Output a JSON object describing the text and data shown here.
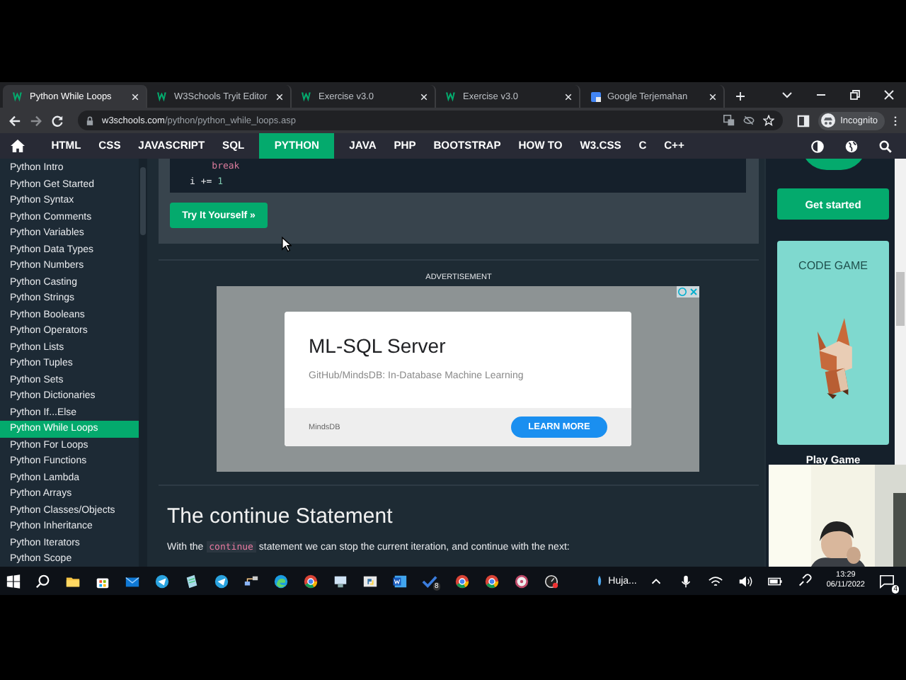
{
  "browser": {
    "tabs": [
      {
        "title": "Python While Loops",
        "selected": true
      },
      {
        "title": "W3Schools Tryit Editor",
        "selected": false
      },
      {
        "title": "Exercise v3.0",
        "selected": false
      },
      {
        "title": "Exercise v3.0",
        "selected": false
      },
      {
        "title": "Google Terjemahan",
        "selected": false
      }
    ],
    "address": {
      "host": "w3schools.com",
      "path": "/python/python_while_loops.asp"
    },
    "profile": "Incognito"
  },
  "nav": {
    "items": [
      {
        "label": "HTML",
        "selected": false
      },
      {
        "label": "CSS",
        "selected": false
      },
      {
        "label": "JAVASCRIPT",
        "selected": false
      },
      {
        "label": "SQL",
        "selected": false
      },
      {
        "label": "PYTHON",
        "selected": true
      },
      {
        "label": "JAVA",
        "selected": false
      },
      {
        "label": "PHP",
        "selected": false
      },
      {
        "label": "BOOTSTRAP",
        "selected": false
      },
      {
        "label": "HOW TO",
        "selected": false
      },
      {
        "label": "W3.CSS",
        "selected": false
      },
      {
        "label": "C",
        "selected": false
      },
      {
        "label": "C++",
        "selected": false
      }
    ]
  },
  "sidebar": {
    "items": [
      {
        "label": "Python Intro",
        "selected": false
      },
      {
        "label": "Python Get Started",
        "selected": false
      },
      {
        "label": "Python Syntax",
        "selected": false
      },
      {
        "label": "Python Comments",
        "selected": false
      },
      {
        "label": "Python Variables",
        "selected": false
      },
      {
        "label": "Python Data Types",
        "selected": false
      },
      {
        "label": "Python Numbers",
        "selected": false
      },
      {
        "label": "Python Casting",
        "selected": false
      },
      {
        "label": "Python Strings",
        "selected": false
      },
      {
        "label": "Python Booleans",
        "selected": false
      },
      {
        "label": "Python Operators",
        "selected": false
      },
      {
        "label": "Python Lists",
        "selected": false
      },
      {
        "label": "Python Tuples",
        "selected": false
      },
      {
        "label": "Python Sets",
        "selected": false
      },
      {
        "label": "Python Dictionaries",
        "selected": false
      },
      {
        "label": "Python If...Else",
        "selected": false
      },
      {
        "label": "Python While Loops",
        "selected": true
      },
      {
        "label": "Python For Loops",
        "selected": false
      },
      {
        "label": "Python Functions",
        "selected": false
      },
      {
        "label": "Python Lambda",
        "selected": false
      },
      {
        "label": "Python Arrays",
        "selected": false
      },
      {
        "label": "Python Classes/Objects",
        "selected": false
      },
      {
        "label": "Python Inheritance",
        "selected": false
      },
      {
        "label": "Python Iterators",
        "selected": false
      },
      {
        "label": "Python Scope",
        "selected": false
      }
    ]
  },
  "example": {
    "code": [
      [
        {
          "kind": "keyword",
          "text": "    break"
        }
      ],
      [
        {
          "kind": "plain",
          "text": "i += "
        },
        {
          "kind": "number",
          "text": "1"
        }
      ]
    ],
    "button": "Try It Yourself »"
  },
  "ad": {
    "label": "ADVERTISEMENT",
    "title": "ML-SQL Server",
    "subtitle": "GitHub/MindsDB: In-Database Machine Learning",
    "advertiser": "MindsDB",
    "cta": "LEARN MORE"
  },
  "section": {
    "heading": "The continue Statement",
    "paragraph": [
      {
        "kind": "text",
        "text": "With the "
      },
      {
        "kind": "code",
        "text": "continue"
      },
      {
        "kind": "text",
        "text": " statement we can stop the current iteration, and continue with the next:"
      }
    ]
  },
  "right": {
    "button": "Get started",
    "card_title": "CODE GAME",
    "card_link": "Play Game"
  },
  "taskbar": {
    "badge": "8",
    "weather": "Huja...",
    "time": "13:29",
    "date": "06/11/2022",
    "notifications": "4"
  }
}
